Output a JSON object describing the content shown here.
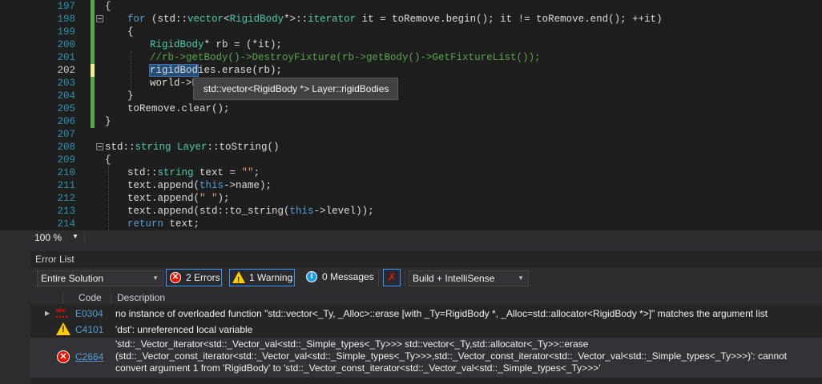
{
  "editor": {
    "line_numbers": [
      "197",
      "198",
      "199",
      "200",
      "201",
      "202",
      "203",
      "204",
      "205",
      "206",
      "207",
      "208",
      "209",
      "210",
      "211",
      "212",
      "213",
      "214"
    ],
    "tooltip": "std::vector<RigidBody *> Layer::rigidBodies",
    "line_202_selected": "rigidBod",
    "line_202_rest": "ies.erase(rb);",
    "line_203_partial": "world->D",
    "zoom": "100 %",
    "code": {
      "l197": "{",
      "l198_for": "for",
      "l198_a": " (std::",
      "l198_vector": "vector",
      "l198_b": "<",
      "l198_rigid": "RigidBody",
      "l198_c": "*>::",
      "l198_iter": "iterator",
      "l198_d": " it = toRemove.begin(); it != toRemove.end(); ++it)",
      "l199": "{",
      "l200_type": "RigidBody",
      "l200_rest": "* rb = (*it);",
      "l201": "//rb->getBody()->DestroyFixture(rb->getBody()->GetFixtureList());",
      "l204": "}",
      "l205": "toRemove.clear();",
      "l206": "}",
      "l208_ns": "std::",
      "l208_string": "string",
      "l208_layer": " Layer",
      "l208_rest": "::toString()",
      "l209": "{",
      "l210_ns": "std::",
      "l210_string": "string",
      "l210_mid": " text = ",
      "l210_str": "\"\"",
      "l210_end": ";",
      "l211_a": "text.append(",
      "l211_this": "this",
      "l211_b": "->name);",
      "l212_a": "text.append(",
      "l212_str": "\" \"",
      "l212_b": ");",
      "l213_a": "text.append(std::to_string(",
      "l213_this": "this",
      "l213_b": "->level));",
      "l214_ret": "return",
      "l214_rest": " text;"
    }
  },
  "error_list": {
    "title": "Error List",
    "scope": "Entire Solution",
    "errors_label": "2 Errors",
    "warnings_label": "1 Warning",
    "messages_label": "0 Messages",
    "build_filter": "Build + IntelliSense",
    "columns": {
      "code": "Code",
      "description": "Description"
    },
    "rows": [
      {
        "code": "E0304",
        "description": "no instance of overloaded function \"std::vector<_Ty, _Alloc>::erase [with _Ty=RigidBody *, _Alloc=std::allocator<RigidBody *>]\" matches the argument list"
      },
      {
        "code": "C4101",
        "description": "'dst': unreferenced local variable"
      },
      {
        "code": "C2664",
        "description": "'std::_Vector_iterator<std::_Vector_val<std::_Simple_types<_Ty>>> std::vector<_Ty,std::allocator<_Ty>>::erase (std::_Vector_const_iterator<std::_Vector_val<std::_Simple_types<_Ty>>>,std::_Vector_const_iterator<std::_Vector_val<std::_Simple_types<_Ty>>>)': cannot convert argument 1 from 'RigidBody' to 'std::_Vector_const_iterator<std::_Vector_val<std::_Simple_types<_Ty>>>'"
      }
    ]
  },
  "colors": {
    "editor_bg": "#1e1e1e",
    "keyword": "#569cd6",
    "type": "#4ec9b0",
    "string": "#d69d85",
    "comment": "#57a64a",
    "line_number": "#2b91af",
    "error": "#e51400",
    "warning": "#ffcc00",
    "info": "#1ba1e2",
    "accent": "#3399ff"
  },
  "icons": [
    "collapse-icon",
    "tooltip-popup",
    "zoom-chevron-icon",
    "error-icon",
    "warning-icon",
    "info-icon",
    "clear-filter-icon",
    "dropdown-chevron-icon",
    "spellcheck-abc-icon",
    "expand-arrow-icon"
  ]
}
